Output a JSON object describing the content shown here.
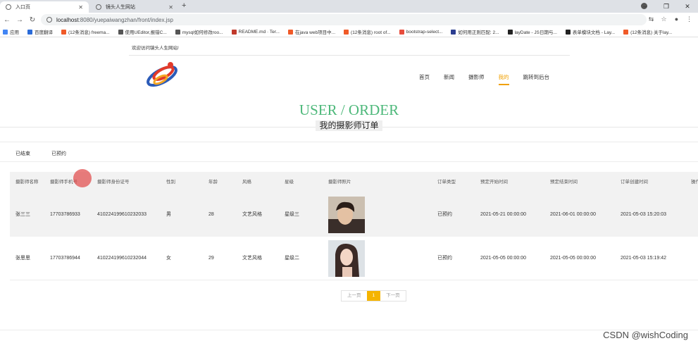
{
  "browser": {
    "tabs": [
      {
        "title": "入口页",
        "active": true
      },
      {
        "title": "镜头人生网站",
        "active": false
      }
    ],
    "url_host": "localhost",
    "url_path": ":8080/yuepaiwangzhan/front/index.jsp",
    "bookmarks": [
      {
        "label": "应用",
        "color": "#4285f4"
      },
      {
        "label": "百度翻译",
        "color": "#2a6bd8"
      },
      {
        "label": "(12条消息) freema...",
        "color": "#f05a28"
      },
      {
        "label": "使用UEditor,报错C...",
        "color": "#555555"
      },
      {
        "label": "mysql如何修改roo...",
        "color": "#555555"
      },
      {
        "label": "README.md · Ter...",
        "color": "#c0392b"
      },
      {
        "label": "在java web项目中...",
        "color": "#f05a28"
      },
      {
        "label": "(12条消息) root of...",
        "color": "#f05a28"
      },
      {
        "label": "bootstrap-select...",
        "color": "#e74c3c"
      },
      {
        "label": "如何用正则匹配: 2...",
        "color": "#2c3e90"
      },
      {
        "label": "layDate - JS日期与...",
        "color": "#222222"
      },
      {
        "label": "表单模块文档 - Lay...",
        "color": "#222222"
      },
      {
        "label": "(12条消息) 关于lay...",
        "color": "#f05a28"
      }
    ]
  },
  "header": {
    "welcome": "欢迎访问镜头人生网站!",
    "nav": [
      {
        "label": "首页",
        "active": false
      },
      {
        "label": "新闻",
        "active": false
      },
      {
        "label": "摄影师",
        "active": false
      },
      {
        "label": "我的",
        "active": true
      },
      {
        "label": "跳转到后台",
        "active": false
      }
    ]
  },
  "page": {
    "title_en": "USER / ORDER",
    "title_cn": "我的摄影师订单"
  },
  "filters": [
    "已结束",
    "已预约"
  ],
  "table": {
    "columns": [
      "摄影师名称",
      "摄影师手机号",
      "摄影师身份证号",
      "性别",
      "年龄",
      "风格",
      "星级",
      "摄影师照片",
      "订单类型",
      "预定开始时间",
      "预定结束时间",
      "订单创建时间",
      "操作"
    ],
    "rows": [
      [
        "张三三",
        "17703786933",
        "410224199610232033",
        "男",
        "28",
        "文艺风格",
        "星级三",
        "",
        "已预约",
        "2021-05-21 00:00:00",
        "2021-06-01 00:00:00",
        "2021-05-03 15:20:03",
        ""
      ],
      [
        "张思思",
        "17703786944",
        "410224199610232044",
        "女",
        "29",
        "文艺风格",
        "星级二",
        "",
        "已预约",
        "2021-05-05 00:00:00",
        "2021-05-05 00:00:00",
        "2021-05-03 15:19:42",
        ""
      ]
    ]
  },
  "pager": {
    "prev": "上一页",
    "current": "1",
    "next": "下一页"
  },
  "watermark": "CSDN @wishCoding",
  "colors": {
    "accent": "#f0a000",
    "title_green": "#4db87a",
    "pager_active": "#f5b400"
  }
}
